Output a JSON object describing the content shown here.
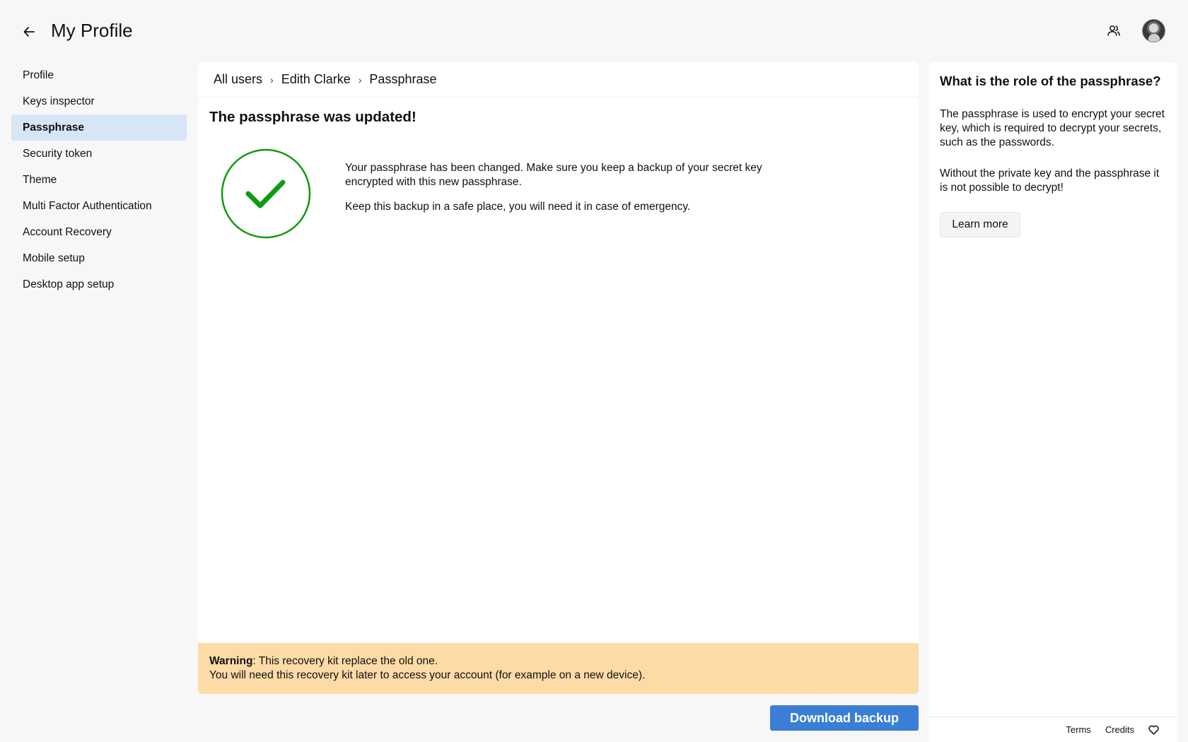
{
  "header": {
    "title": "My Profile",
    "back_icon": "arrow-left-icon",
    "users_icon": "users-icon",
    "avatar": "user-avatar"
  },
  "sidebar": {
    "items": [
      {
        "label": "Profile",
        "active": false
      },
      {
        "label": "Keys inspector",
        "active": false
      },
      {
        "label": "Passphrase",
        "active": true
      },
      {
        "label": "Security token",
        "active": false
      },
      {
        "label": "Theme",
        "active": false
      },
      {
        "label": "Multi Factor Authentication",
        "active": false
      },
      {
        "label": "Account Recovery",
        "active": false
      },
      {
        "label": "Mobile setup",
        "active": false
      },
      {
        "label": "Desktop app setup",
        "active": false
      }
    ]
  },
  "breadcrumb": {
    "items": [
      "All users",
      "Edith Clarke",
      "Passphrase"
    ],
    "separator": "›"
  },
  "main": {
    "title": "The passphrase was updated!",
    "message_1": "Your passphrase has been changed. Make sure you keep a backup of your secret key encrypted with this new passphrase.",
    "message_2": "Keep this backup in a safe place, you will need it in case of emergency.",
    "success_icon": "check-circle-icon",
    "success_color": "#0f9b0f"
  },
  "warning": {
    "label": "Warning",
    "line_1": ": This recovery kit replace the old one.",
    "line_2": "You will need this recovery kit later to access your account (for example on a new device).",
    "background": "#fddba6"
  },
  "actions": {
    "download_label": "Download backup",
    "accent": "#3a7fd5"
  },
  "help": {
    "title": "What is the role of the passphrase?",
    "paragraph_1": "The passphrase is used to encrypt your secret key, which is required to decrypt your secrets, such as the passwords.",
    "paragraph_2": "Without the private key and the passphrase it is not possible to decrypt!",
    "learn_more_label": "Learn more"
  },
  "footer": {
    "terms": "Terms",
    "credits": "Credits",
    "heart_icon": "heart-icon"
  }
}
